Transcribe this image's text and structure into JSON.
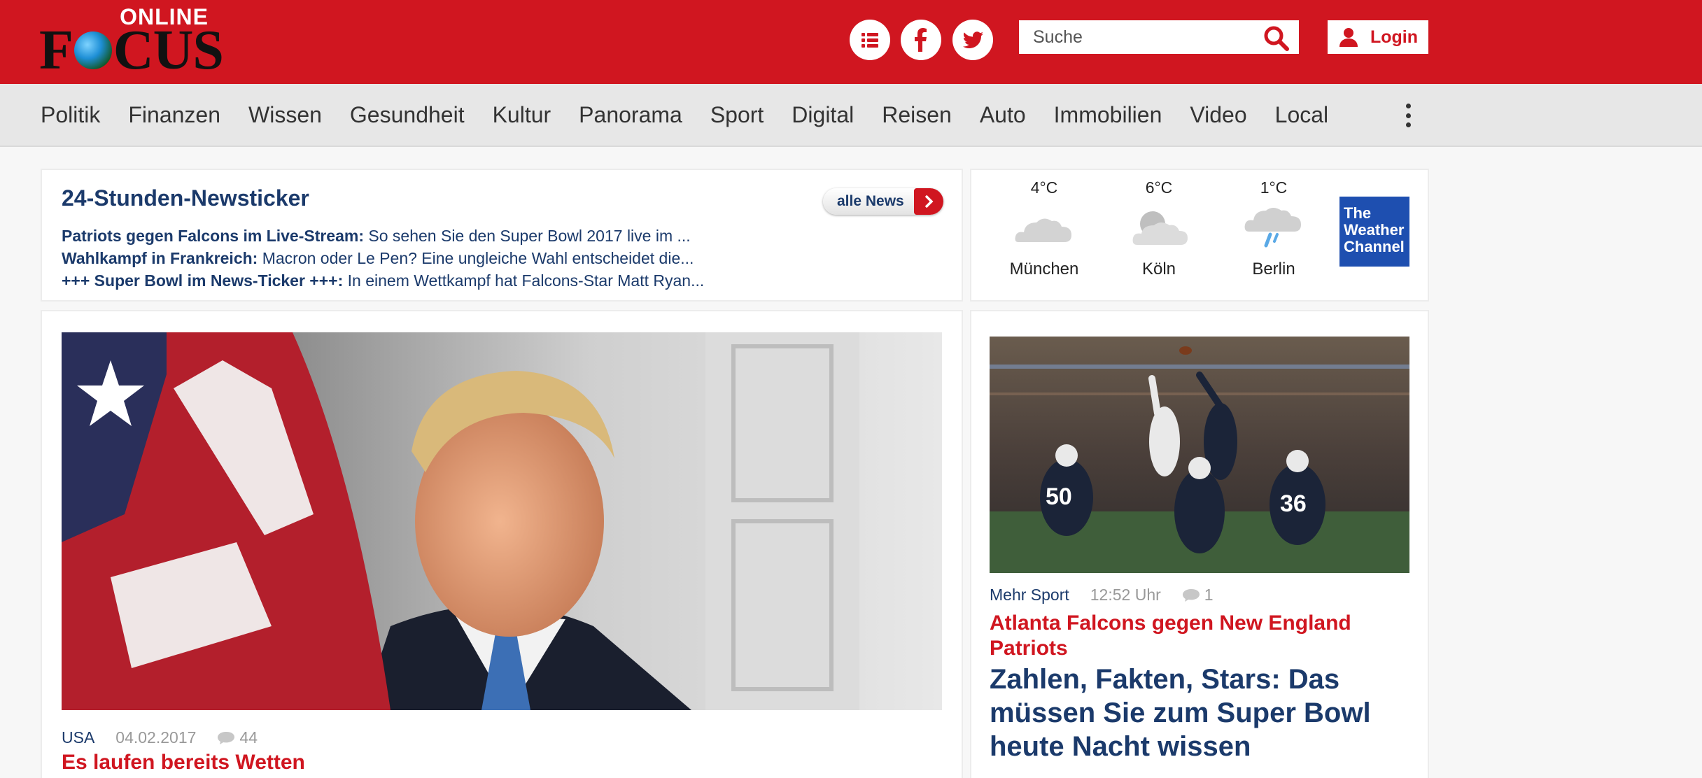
{
  "header": {
    "logo_top": "ONLINE",
    "logo_focus_left": "F",
    "logo_focus_right": "CUS",
    "search": {
      "placeholder": "Suche"
    },
    "login_label": "Login",
    "brand_color": "#d01620"
  },
  "nav": {
    "items": [
      "Politik",
      "Finanzen",
      "Wissen",
      "Gesundheit",
      "Kultur",
      "Panorama",
      "Sport",
      "Digital",
      "Reisen",
      "Auto",
      "Immobilien",
      "Video",
      "Local"
    ]
  },
  "ticker": {
    "title": "24-Stunden-Newsticker",
    "all_news_label": "alle News",
    "items": [
      {
        "lead": "Patriots gegen Falcons im Live-Stream:",
        "text": " So sehen Sie den Super Bowl 2017 live im ..."
      },
      {
        "lead": "Wahlkampf in Frankreich:",
        "text": " Macron oder Le Pen? Eine ungleiche Wahl entscheidet die..."
      },
      {
        "lead": "+++ Super Bowl im News-Ticker +++:",
        "text": " In einem Wettkampf hat Falcons-Star Matt Ryan..."
      }
    ]
  },
  "weather": {
    "cities": [
      {
        "temp": "4°C",
        "city": "München",
        "icon": "cloud-icon"
      },
      {
        "temp": "6°C",
        "city": "Köln",
        "icon": "partly-cloudy-icon"
      },
      {
        "temp": "1°C",
        "city": "Berlin",
        "icon": "rain-cloud-icon"
      }
    ],
    "partner_line1": "The",
    "partner_line2": "Weather",
    "partner_line3": "Channel"
  },
  "main_article": {
    "category": "USA",
    "date": "04.02.2017",
    "comments": "44",
    "kicker": "Es laufen bereits Wetten"
  },
  "side_article": {
    "category": "Mehr Sport",
    "time": "12:52 Uhr",
    "comments": "1",
    "kicker": "Atlanta Falcons gegen New England Patriots",
    "headline": "Zahlen, Fakten, Stars: Das müssen Sie zum Super Bowl heute Nacht wissen"
  }
}
